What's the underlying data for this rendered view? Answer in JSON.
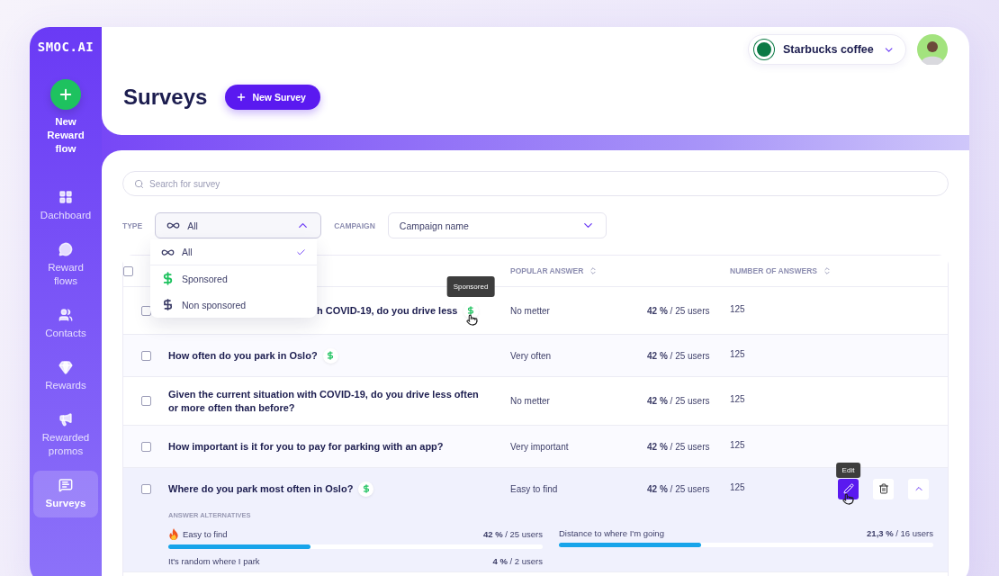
{
  "sidebar": {
    "logo": "SMOC.AI",
    "new_flow": "New Reward flow",
    "items": [
      {
        "label": "Dachboard",
        "kind": "dashboard",
        "selected": false
      },
      {
        "label": "Reward flows",
        "kind": "chat",
        "selected": false
      },
      {
        "label": "Contacts",
        "kind": "contacts",
        "selected": false
      },
      {
        "label": "Rewards",
        "kind": "diamond",
        "selected": false
      },
      {
        "label": "Rewarded promos",
        "kind": "promo",
        "selected": false
      },
      {
        "label": "Surveys",
        "kind": "survey",
        "selected": true
      }
    ]
  },
  "header": {
    "title": "Surveys",
    "new_button": "New Survey",
    "account": "Starbucks coffee"
  },
  "search": {
    "placeholder": "Search for survey"
  },
  "filters": [
    {
      "label": "TYPE",
      "value": "All",
      "expanded": true
    },
    {
      "label": "CAMPAIGN",
      "value": "Campaign name",
      "expanded": false
    }
  ],
  "type_menu": [
    {
      "label": "All",
      "kind": "all",
      "selected": true
    },
    {
      "label": "Sponsored",
      "kind": "sponsored",
      "selected": false
    },
    {
      "label": "Non sponsored",
      "kind": "non_sponsored",
      "selected": false
    }
  ],
  "table": {
    "select_all": {
      "checked": false
    },
    "columns": [
      {
        "label": "POPULAR ANSWER"
      },
      {
        "label": "NUMBER OF ANSWERS"
      }
    ],
    "rows": [
      {
        "question": "h COVID-19, do you drive less",
        "sponsored": true,
        "tooltip": "Sponsored",
        "popular_answer": "No metter",
        "share": "**42 %** / 25 users",
        "answers": "125",
        "checked": false,
        "expanded": false
      },
      {
        "question": "How often do you park in Oslo?",
        "sponsored": true,
        "popular_answer": "Very often",
        "share": "**42 %** / 25 users",
        "answers": "125",
        "checked": false,
        "expanded": false
      },
      {
        "question": "Given the current situation with COVID-19, do you drive less often or more often than before?",
        "sponsored": false,
        "popular_answer": "No metter",
        "share": "**42 %** / 25 users",
        "answers": "125",
        "checked": false,
        "expanded": false
      },
      {
        "question": "How important is it for you to pay for parking with an app?",
        "sponsored": false,
        "popular_answer": "Very important",
        "share": "**42 %** / 25 users",
        "answers": "125",
        "checked": false,
        "expanded": false
      },
      {
        "question": "Where do you park most often in Oslo?",
        "sponsored": true,
        "popular_answer": "Easy to find",
        "share": "**42 %** / 25 users",
        "answers": "125",
        "checked": false,
        "expanded": true,
        "action_tooltip": "Edit",
        "alternatives_title": "ANSWER ALTERNATIVES",
        "alternatives": [
          {
            "label": "Easy to find",
            "hot": true,
            "share": "**42 %** / 25 users",
            "level": 0.38
          },
          {
            "label": "Distance to where I'm going",
            "hot": false,
            "share": "**21,3 %** / 16 users",
            "level": 0.38
          },
          {
            "label": "It's random where I park",
            "hot": false,
            "share": "**4 %** / 2 users"
          }
        ]
      }
    ]
  }
}
